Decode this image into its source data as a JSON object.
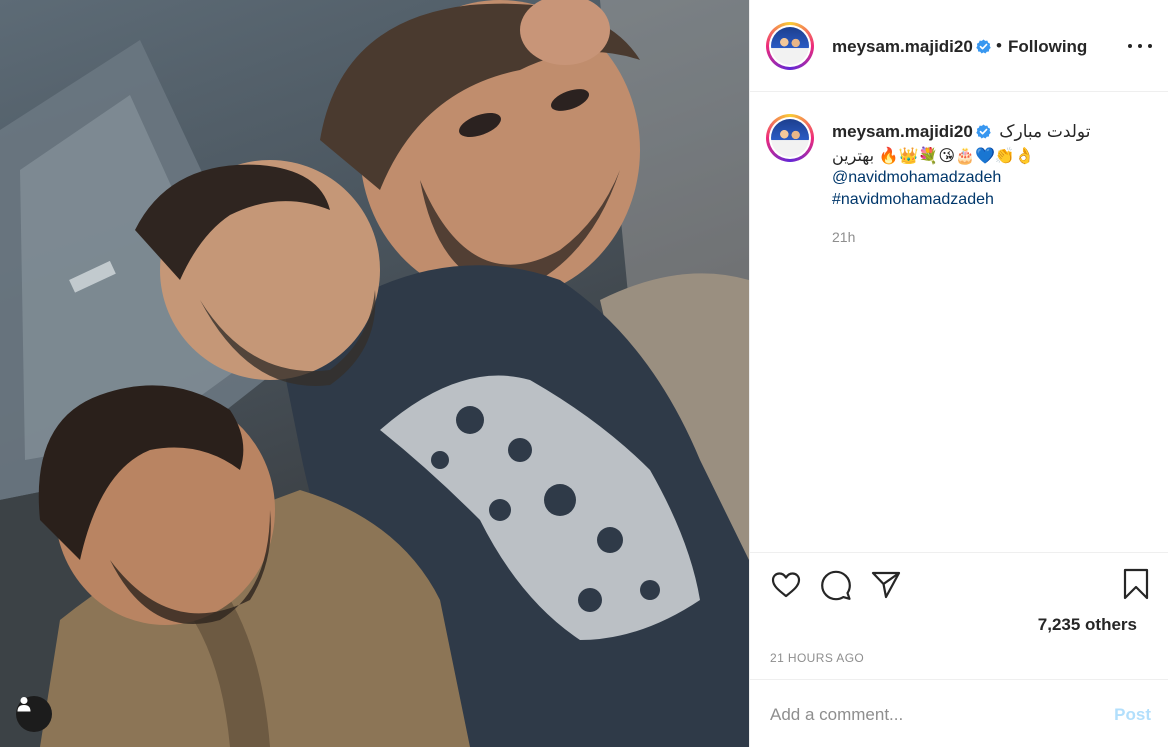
{
  "post": {
    "username": "meysam.majidi20",
    "follow_status": "Following",
    "separator": "•",
    "caption_line1": "تولدت مبارک",
    "caption_line2_emojis": "🔥👑💐😘🎂💙👏👌",
    "caption_line2_text": "بهترین",
    "mention": "@navidmohamadzadeh",
    "hashtag": "#navidmohamadzadeh",
    "caption_age": "21h",
    "likes_text": "7,235 others",
    "timestamp": "21 HOURS AGO"
  },
  "comment_box": {
    "placeholder": "Add a comment...",
    "post_label": "Post"
  },
  "icons": {
    "verified": "verified-badge-icon",
    "more": "more-options-icon",
    "like": "heart-icon",
    "comment": "comment-bubble-icon",
    "share": "paper-plane-icon",
    "save": "bookmark-icon",
    "user_tags": "user-icon"
  },
  "colors": {
    "verified_blue": "#3897f0",
    "link_blue": "#00376b",
    "post_disabled": "#b2dffc",
    "secondary_text": "#8e8e8e"
  }
}
